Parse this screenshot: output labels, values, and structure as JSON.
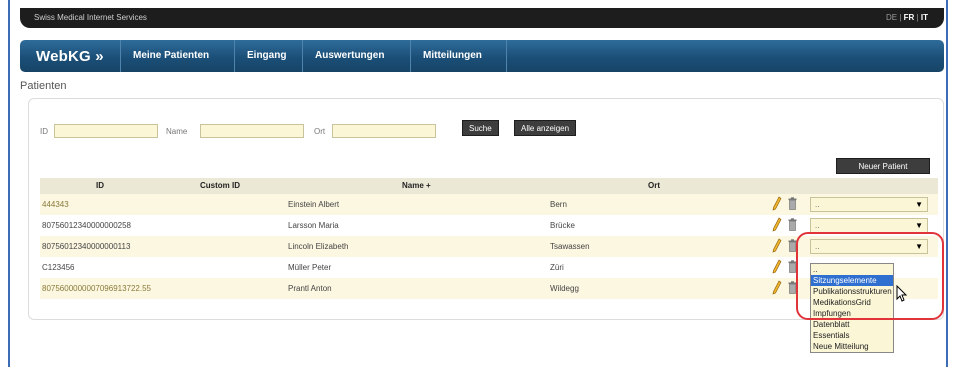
{
  "topbar": {
    "brand": "Swiss Medical Internet Services",
    "lang_de": "DE",
    "lang_fr": "FR",
    "lang_it": "IT",
    "sep": "|"
  },
  "nav": {
    "logo": "WebKG »",
    "items": [
      "Meine Patienten",
      "Eingang",
      "Auswertungen",
      "Mitteilungen"
    ]
  },
  "page_title": "Patienten",
  "search": {
    "id_label": "ID",
    "name_label": "Name",
    "ort_label": "Ort",
    "id_value": "",
    "name_value": "",
    "ort_value": "",
    "search_button": "Suche",
    "show_all_button": "Alle anzeigen",
    "new_patient_button": "Neuer Patient"
  },
  "table": {
    "headers": [
      "ID",
      "Custom ID",
      "Name +",
      "Ort"
    ],
    "rows": [
      {
        "id": "444343",
        "custom_id": "",
        "name": "Einstein Albert",
        "ort": "Bern",
        "select": ".."
      },
      {
        "id": "80756012340000000258",
        "custom_id": "",
        "name": "Larsson Maria",
        "ort": "Brücke",
        "select": ".."
      },
      {
        "id": "80756012340000000113",
        "custom_id": "",
        "name": "Lincoln Elizabeth",
        "ort": "Tsawassen",
        "select": ".."
      },
      {
        "id": "C123456",
        "custom_id": "",
        "name": "Müller Peter",
        "ort": "Züri",
        "select": ""
      },
      {
        "id": "8075600000007096913722.55",
        "custom_id": "",
        "name": "Prantl Anton",
        "ort": "Wildegg",
        "select": ""
      }
    ]
  },
  "dropdown": {
    "options": [
      "..",
      "Sitzungselemente",
      "Publikationsstrukturen",
      "MedikationsGrid",
      "Impfungen",
      "Datenblatt",
      "Essentials",
      "Neue Mitteilung"
    ],
    "highlighted_index": 1
  },
  "colors": {
    "nav": "#1b4f78",
    "highlight_ring": "#e1343a",
    "row_alt": "#fcf7e1",
    "selection": "#2f6fd0"
  }
}
